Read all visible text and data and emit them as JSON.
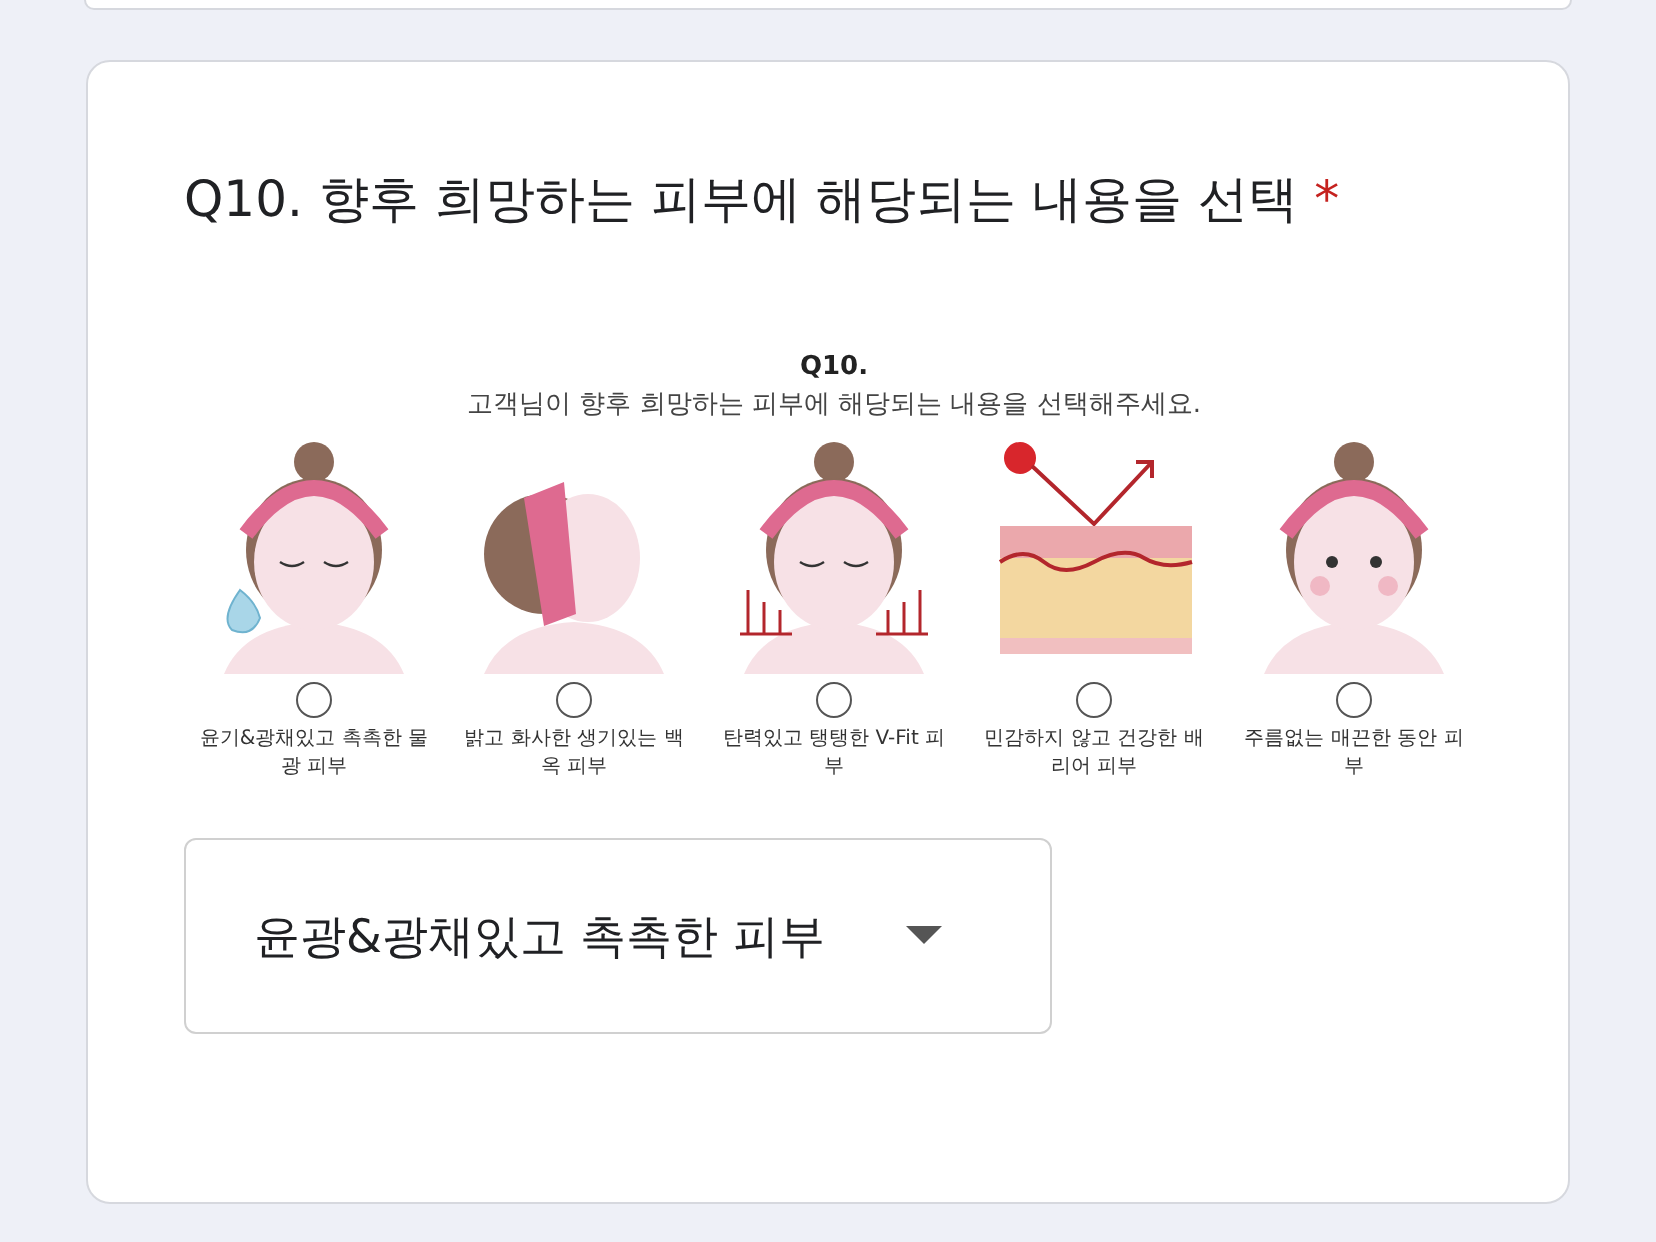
{
  "question": {
    "title": "Q10. 향후 희망하는 피부에 해당되는 내용을 선택",
    "required_mark": "*"
  },
  "image": {
    "heading": "Q10.",
    "subtitle": "고객님이 향후 희망하는 피부에 해당되는 내용을 선택해주세요.",
    "options": [
      {
        "kind": "water",
        "label": "윤기&광채있고 촉촉한 물광 피부",
        "selected": false
      },
      {
        "kind": "profile",
        "label": "밝고 화사한 생기있는 백옥 피부",
        "selected": false
      },
      {
        "kind": "lift",
        "label": "탄력있고 탱탱한 V-Fit 피부",
        "selected": false
      },
      {
        "kind": "barrier",
        "label": "민감하지 않고 건강한 배리어 피부",
        "selected": false
      },
      {
        "kind": "youth",
        "label": "주름없는 매끈한 동안 피부",
        "selected": false
      }
    ]
  },
  "dropdown": {
    "value": "윤광&광채있고 촉촉한 피부"
  }
}
